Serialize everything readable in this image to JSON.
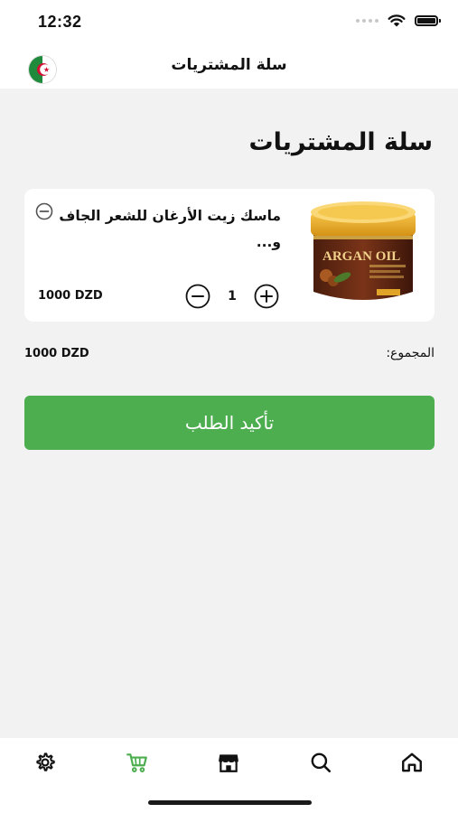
{
  "status_bar": {
    "time": "12:32"
  },
  "header": {
    "title": "سلة المشتريات",
    "flag_icon": "algeria-flag-icon"
  },
  "page": {
    "heading": "سلة المشتريات"
  },
  "cart": {
    "items": [
      {
        "name": "ماسك زيت الأرغان للشعر الجاف و...",
        "image_text": "ARGAN OIL",
        "quantity": "1",
        "price": "1000 DZD"
      }
    ]
  },
  "summary": {
    "total_label": "المجموع:",
    "total_value": "1000 DZD"
  },
  "actions": {
    "confirm_label": "تأكيد الطلب"
  },
  "tab_bar": {
    "tabs": [
      "settings-icon",
      "cart-icon",
      "store-icon",
      "search-icon",
      "home-icon"
    ],
    "active": "cart-icon"
  },
  "colors": {
    "accent": "#4cae4f",
    "background": "#f2f2f2"
  }
}
